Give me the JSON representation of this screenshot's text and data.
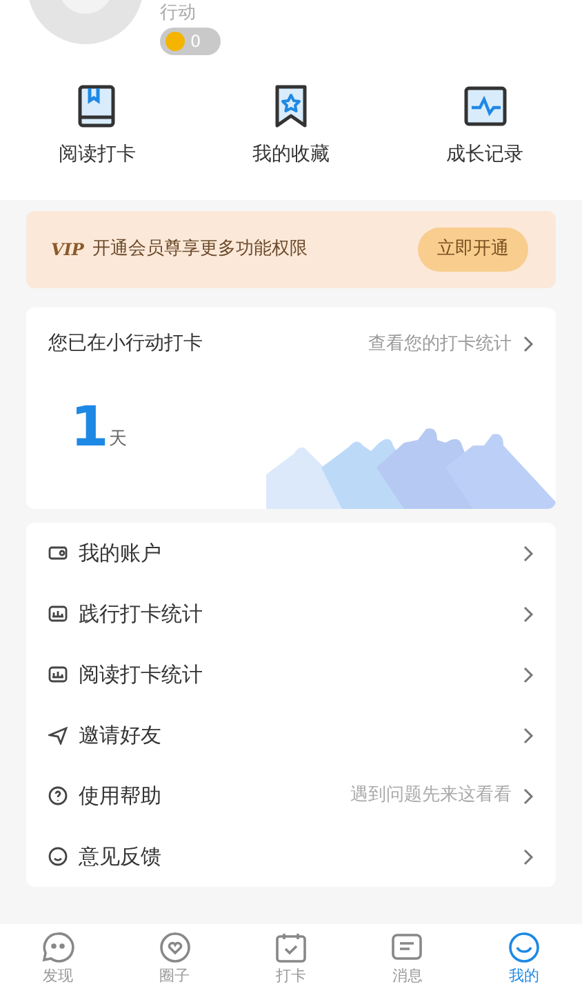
{
  "profile": {
    "name": "行动",
    "coins": "0"
  },
  "shortcuts": [
    {
      "label": "阅读打卡",
      "kind": "book"
    },
    {
      "label": "我的收藏",
      "kind": "star"
    },
    {
      "label": "成长记录",
      "kind": "pulse"
    }
  ],
  "vip": {
    "badge": "VIP",
    "text": "开通会员尊享更多功能权限",
    "button": "立即开通"
  },
  "checkin": {
    "title": "您已在小行动打卡",
    "link": "查看您的打卡统计",
    "days": "1",
    "unit": "天"
  },
  "menu": [
    {
      "label": "我的账户",
      "kind": "wallet"
    },
    {
      "label": "践行打卡统计",
      "kind": "chart"
    },
    {
      "label": "阅读打卡统计",
      "kind": "chart"
    },
    {
      "label": "邀请好友",
      "kind": "send"
    },
    {
      "label": "使用帮助",
      "kind": "help",
      "hint": "遇到问题先来这看看"
    },
    {
      "label": "意见反馈",
      "kind": "feedback"
    }
  ],
  "tabs": [
    {
      "label": "发现",
      "kind": "discover",
      "selected": false
    },
    {
      "label": "圈子",
      "kind": "circle",
      "selected": false
    },
    {
      "label": "打卡",
      "kind": "checkin",
      "selected": false
    },
    {
      "label": "消息",
      "kind": "message",
      "selected": false
    },
    {
      "label": "我的",
      "kind": "me",
      "selected": true
    }
  ]
}
